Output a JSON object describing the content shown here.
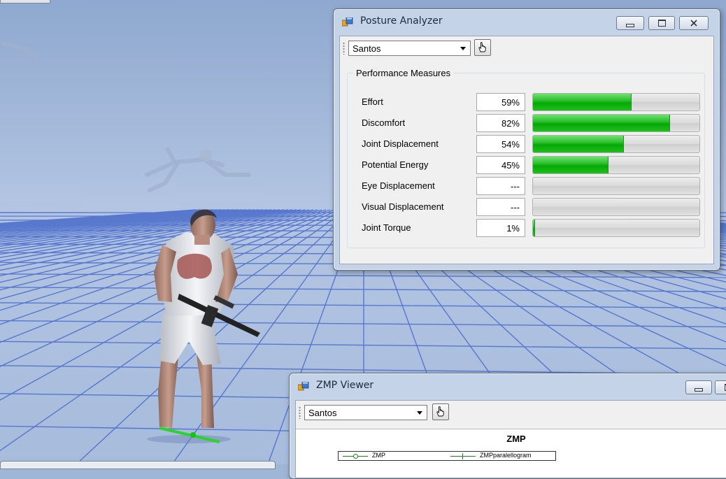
{
  "posture_analyzer": {
    "title": "Posture Analyzer",
    "selected_avatar": "Santos",
    "group_title": "Performance Measures",
    "measures": [
      {
        "label": "Effort",
        "value": "59%",
        "level": 0.59
      },
      {
        "label": "Discomfort",
        "value": "82%",
        "level": 0.82
      },
      {
        "label": "Joint Displacement",
        "value": "54%",
        "level": 0.54
      },
      {
        "label": "Potential Energy",
        "value": "45%",
        "level": 0.45
      },
      {
        "label": "Eye Displacement",
        "value": "---",
        "level": 0
      },
      {
        "label": "Visual Displacement",
        "value": "---",
        "level": 0
      },
      {
        "label": "Joint Torque",
        "value": "1%",
        "level": 0.01
      }
    ],
    "bar_color": "#0aa80a"
  },
  "zmp_viewer": {
    "title": "ZMP Viewer",
    "selected_avatar": "Santos",
    "plot_title": "ZMP",
    "legend": [
      {
        "label": "ZMP",
        "color": "#1a8a1a"
      },
      {
        "label": "ZMPparalellogram",
        "color": "#1a8a1a"
      }
    ]
  },
  "icons": [
    "app-window-icon",
    "minimize-icon",
    "maximize-icon",
    "close-icon",
    "hand-pointer-icon",
    "dropdown-arrow-icon"
  ]
}
